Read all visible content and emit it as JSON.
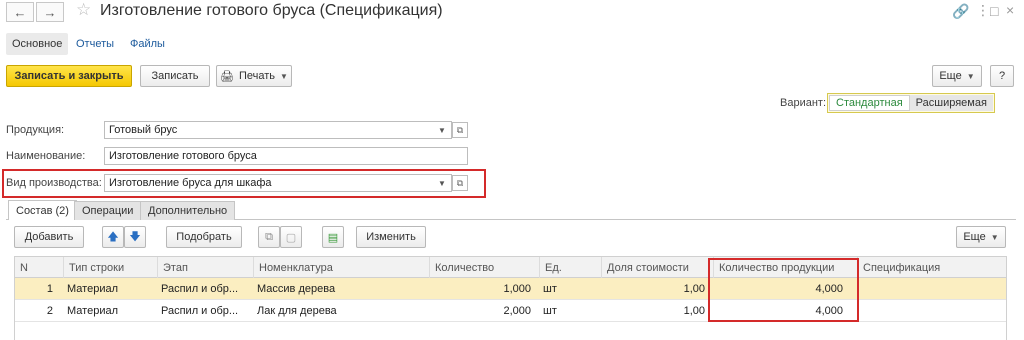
{
  "window": {
    "title": "Изготовление готового бруса (Спецификация)"
  },
  "page_tabs": [
    {
      "label": "Основное"
    },
    {
      "label": "Отчеты"
    },
    {
      "label": "Файлы"
    }
  ],
  "toolbar": {
    "save_close": "Записать и закрыть",
    "save": "Записать",
    "print": "Печать",
    "more": "Еще",
    "help": "?"
  },
  "variant": {
    "label": "Вариант:",
    "options": [
      "Стандартная",
      "Расширяемая"
    ],
    "selected": "Стандартная"
  },
  "form": {
    "product_label": "Продукция:",
    "product_value": "Готовый брус",
    "name_label": "Наименование:",
    "name_value": "Изготовление готового бруса",
    "prodtype_label": "Вид производства:",
    "prodtype_value": "Изготовление бруса для шкафа"
  },
  "inner_tabs": [
    {
      "label": "Состав (2)"
    },
    {
      "label": "Операции"
    },
    {
      "label": "Дополнительно"
    }
  ],
  "table_toolbar": {
    "add": "Добавить",
    "pick": "Подобрать",
    "change": "Изменить",
    "more": "Еще"
  },
  "table": {
    "columns": [
      "N",
      "Тип строки",
      "Этап",
      "Номенклатура",
      "Количество",
      "Ед.",
      "Доля стоимости",
      "Количество продукции",
      "Спецификация"
    ],
    "rows": [
      {
        "n": "1",
        "type": "Материал",
        "stage": "Распил и обр...",
        "item": "Массив дерева",
        "qty": "1,000",
        "unit": "шт",
        "share": "1,00",
        "prod_qty": "4,000",
        "spec": ""
      },
      {
        "n": "2",
        "type": "Материал",
        "stage": "Распил и обр...",
        "item": "Лак для дерева",
        "qty": "2,000",
        "unit": "шт",
        "share": "1,00",
        "prod_qty": "4,000",
        "spec": ""
      }
    ]
  },
  "colors": {
    "accent_yellow": "#f5c802",
    "selected_row": "#fbeec1",
    "highlight_red": "#d42a2a",
    "link_blue": "#1c5a9c"
  }
}
